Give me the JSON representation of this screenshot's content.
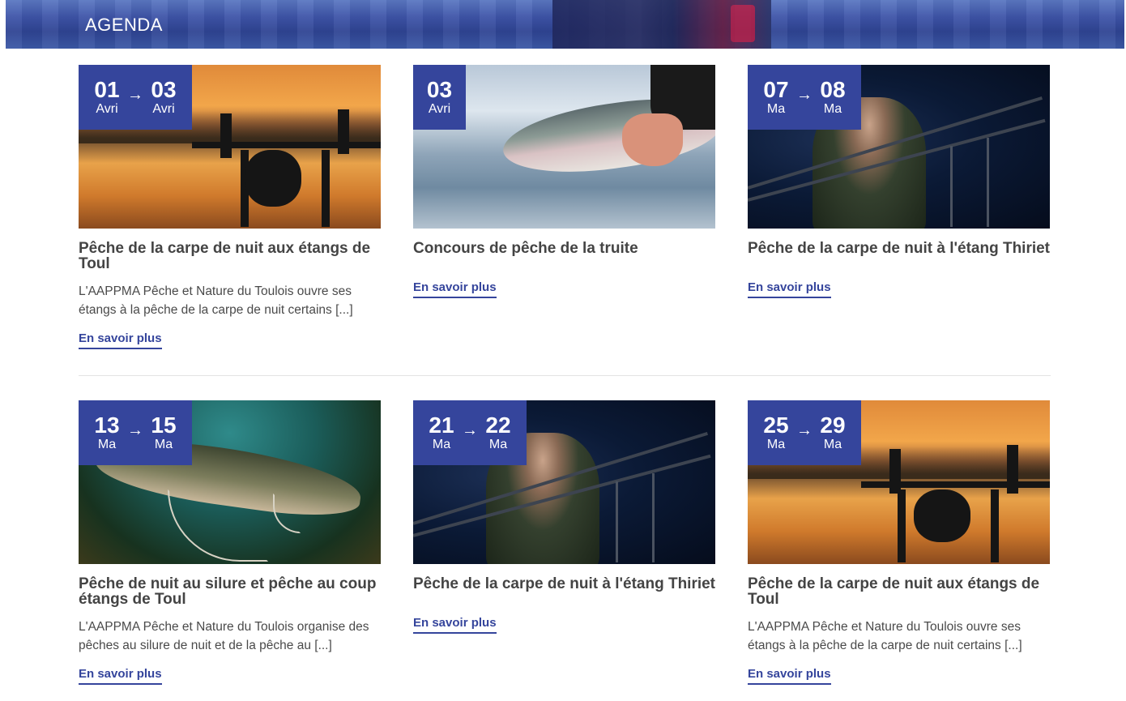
{
  "banner": {
    "title": "AGENDA"
  },
  "events": [
    {
      "date_from": {
        "day": "01",
        "month": "Avri"
      },
      "date_to": {
        "day": "03",
        "month": "Avri"
      },
      "title": "Pêche de la carpe de nuit aux étangs de Toul",
      "excerpt": "L'AAPPMA Pêche et Nature du Toulois ouvre ses étangs à la pêche de la carpe de nuit certains [...]",
      "link": "En savoir plus",
      "image": "carp-rig-sunset"
    },
    {
      "date_from": {
        "day": "03",
        "month": "Avri"
      },
      "title": "Concours de pêche de la truite",
      "excerpt": "",
      "link": "En savoir plus",
      "image": "trout-in-hand"
    },
    {
      "date_from": {
        "day": "07",
        "month": "Ma"
      },
      "date_to": {
        "day": "08",
        "month": "Ma"
      },
      "title": "Pêche de la carpe de nuit à l'étang Thiriet",
      "excerpt": "",
      "link": "En savoir plus",
      "image": "night-angler-headlamp"
    },
    {
      "date_from": {
        "day": "13",
        "month": "Ma"
      },
      "date_to": {
        "day": "15",
        "month": "Ma"
      },
      "title": "Pêche de nuit au silure et pêche au coup étangs de Toul",
      "excerpt": "L'AAPPMA Pêche et Nature du Toulois organise des pêches au silure de nuit et de la pêche au [...]",
      "link": "En savoir plus",
      "image": "catfish-underwater"
    },
    {
      "date_from": {
        "day": "21",
        "month": "Ma"
      },
      "date_to": {
        "day": "22",
        "month": "Ma"
      },
      "title": "Pêche de la carpe de nuit à l'étang Thiriet",
      "excerpt": "",
      "link": "En savoir plus",
      "image": "night-angler-headlamp"
    },
    {
      "date_from": {
        "day": "25",
        "month": "Ma"
      },
      "date_to": {
        "day": "29",
        "month": "Ma"
      },
      "title": "Pêche de la carpe de nuit aux étangs de Toul",
      "excerpt": "L'AAPPMA Pêche et Nature du Toulois ouvre ses étangs à la pêche de la carpe de nuit certains [...]",
      "link": "En savoir plus",
      "image": "carp-rig-sunset"
    }
  ],
  "icons": {
    "date_arrow": "arrow-right-icon"
  },
  "colors": {
    "accent": "#35459c",
    "banner": "#3e54a8",
    "heading": "#444444",
    "text": "#4a4a4a"
  }
}
